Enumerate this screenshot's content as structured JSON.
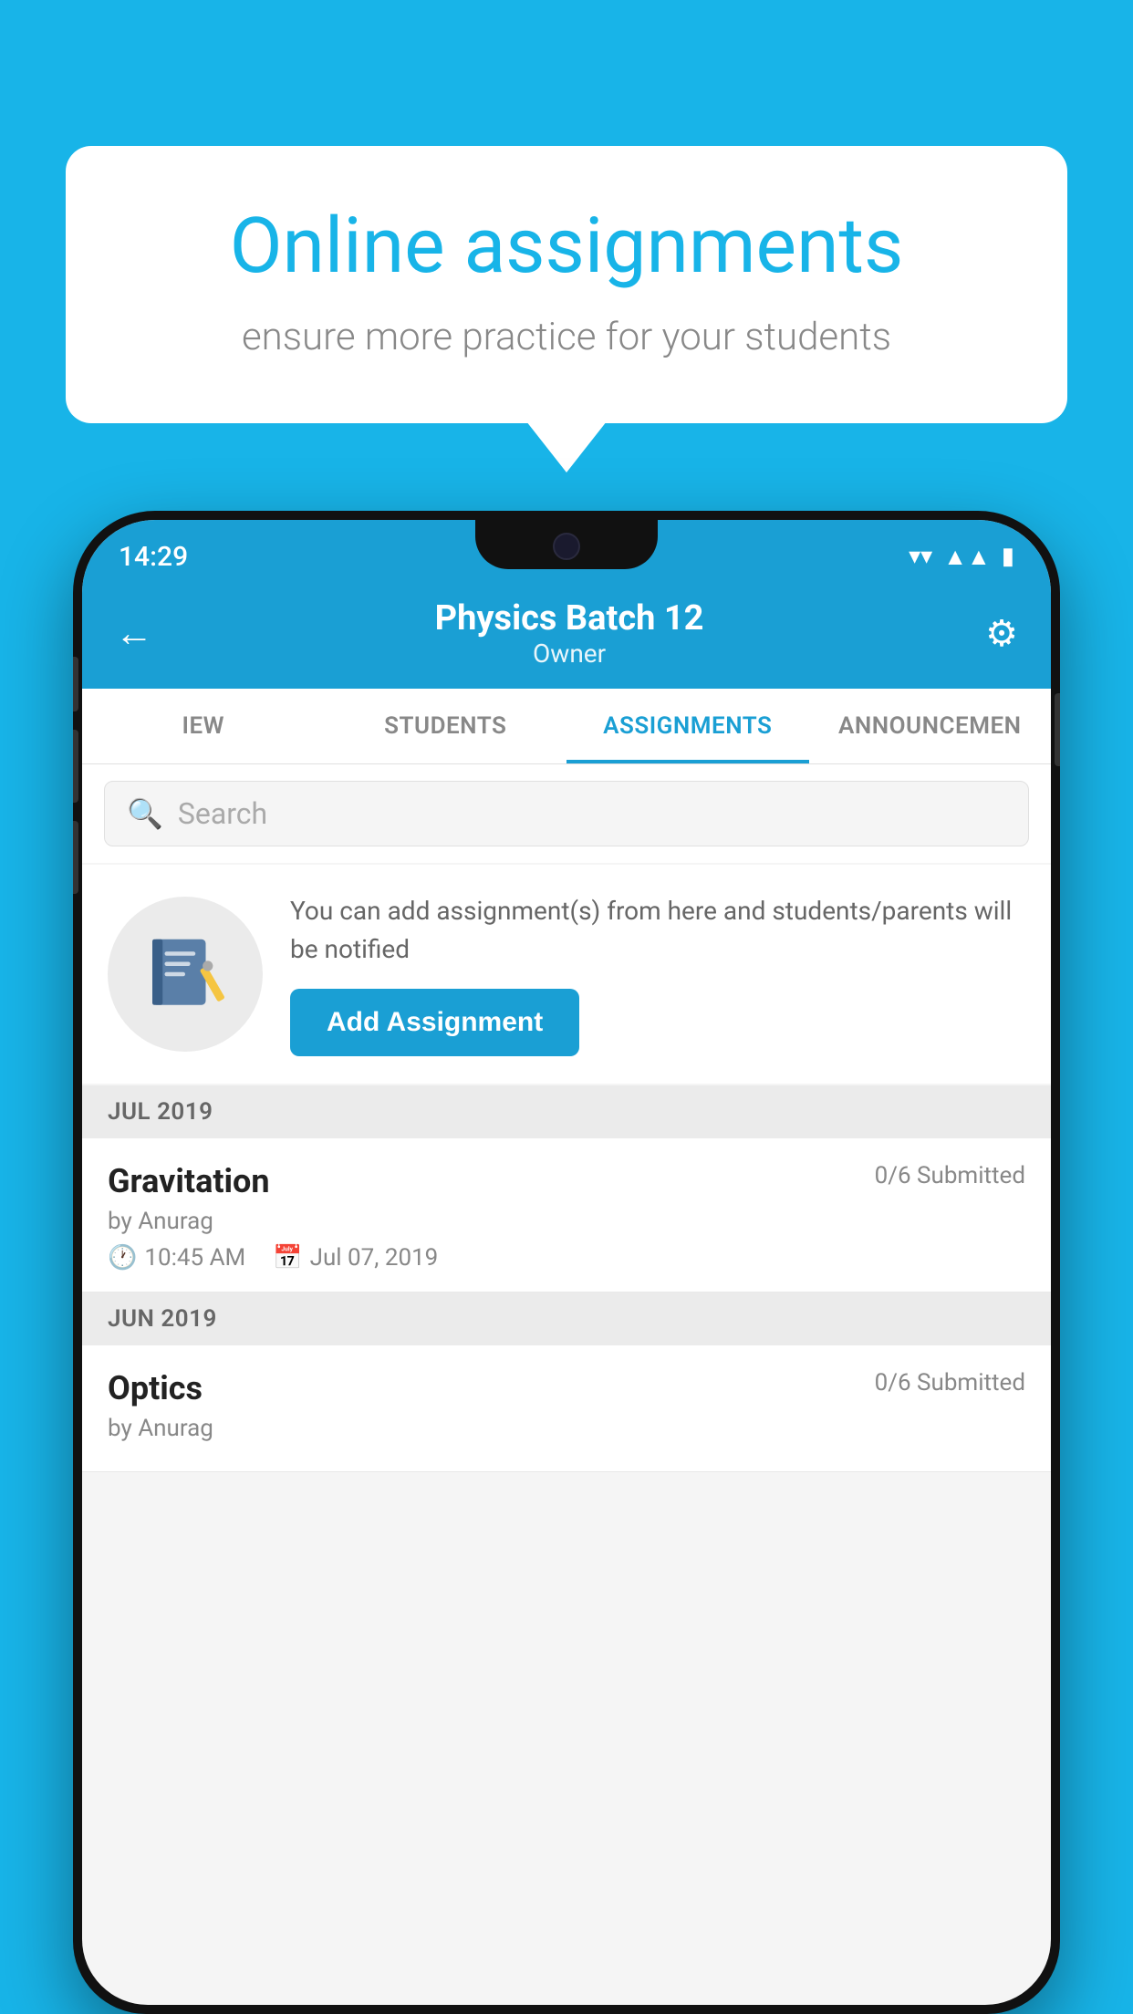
{
  "background_color": "#18b4e8",
  "speech_bubble": {
    "title": "Online assignments",
    "subtitle": "ensure more practice for your students"
  },
  "status_bar": {
    "time": "14:29",
    "wifi_icon": "▲",
    "signal_icon": "▲",
    "battery_icon": "▮"
  },
  "header": {
    "title": "Physics Batch 12",
    "subtitle": "Owner",
    "back_label": "←",
    "settings_label": "⚙"
  },
  "tabs": [
    {
      "label": "IEW",
      "active": false
    },
    {
      "label": "STUDENTS",
      "active": false
    },
    {
      "label": "ASSIGNMENTS",
      "active": true
    },
    {
      "label": "ANNOUNCEM...",
      "active": false
    }
  ],
  "search": {
    "placeholder": "Search"
  },
  "add_assignment_section": {
    "description": "You can add assignment(s) from here and students/parents will be notified",
    "button_label": "Add Assignment"
  },
  "sections": [
    {
      "month": "JUL 2019",
      "assignments": [
        {
          "title": "Gravitation",
          "submitted": "0/6 Submitted",
          "author": "by Anurag",
          "time": "10:45 AM",
          "date": "Jul 07, 2019"
        }
      ]
    },
    {
      "month": "JUN 2019",
      "assignments": [
        {
          "title": "Optics",
          "submitted": "0/6 Submitted",
          "author": "by Anurag",
          "time": "",
          "date": ""
        }
      ]
    }
  ]
}
